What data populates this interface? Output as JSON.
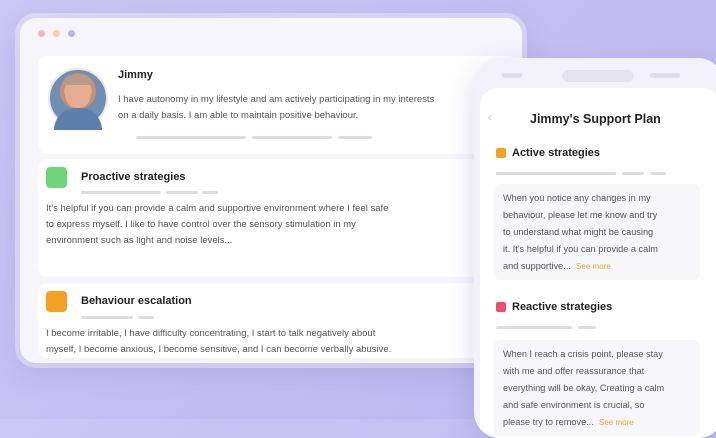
{
  "browser": {
    "dot_colors": [
      "#f4b7b7",
      "#f6d59a",
      "#b9b4f0"
    ]
  },
  "profile": {
    "name": "Jimmy",
    "description_line1": "I have autonomy in my lifestyle and am actively participating in my interests",
    "description_line2": "on a daily basis. I am able to maintain positive behaviour."
  },
  "sections": [
    {
      "title": "Proactive strategies",
      "color": "#6fd57a",
      "lines": [
        "It's helpful if you can provide a calm and supportive environment where I feel safe",
        "to express myself. I like to have control over the sensory stimulation in my",
        "environment such as light and noise levels..."
      ]
    },
    {
      "title": "Behaviour escalation",
      "color": "#f5a020",
      "lines": [
        "I become irritable, I have difficulty concentrating, I start to talk negatively about",
        "myself, I become  anxious, I become sensitive, and I can become verbally abusive."
      ]
    }
  ],
  "mobile": {
    "title": "Jimmy's Support Plan",
    "back_icon": "chevron-left-icon",
    "active": {
      "heading": "Active strategies",
      "color": "#f5a020",
      "lines": [
        "When you notice any changes in my",
        "behaviour, please let me know and try",
        "to understand what might be causing",
        "it. It's helpful if you can provide a calm",
        "and supportive..."
      ],
      "see_more": "See more"
    },
    "reactive": {
      "heading": "Reactive strategies",
      "color": "#ec4f6e",
      "lines": [
        "When I reach a crisis point, please stay",
        "with me and offer reassurance that",
        "everything will be okay, Creating a calm",
        "and safe environment is crucial, so",
        "please try to remove..."
      ],
      "see_more": "See more"
    }
  }
}
